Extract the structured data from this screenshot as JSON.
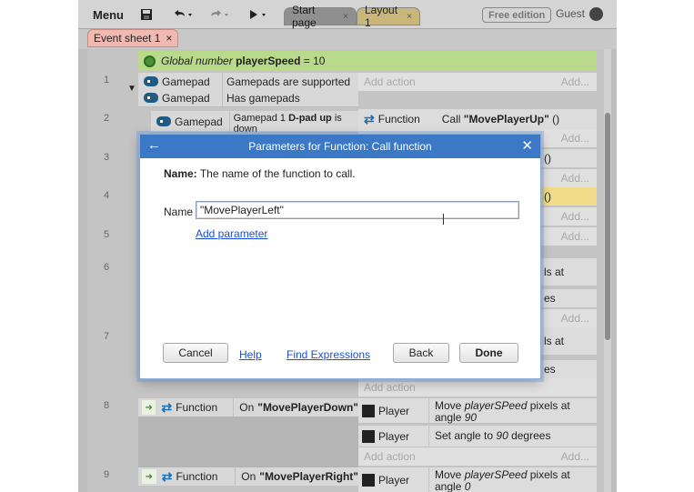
{
  "toolbar": {
    "menu_label": "Menu",
    "tabs": [
      {
        "label": "Start page",
        "close": "×"
      },
      {
        "label": "Layout 1",
        "close": "×"
      }
    ],
    "edition_badge": "Free edition",
    "user_name": "Guest"
  },
  "sheet_tab": {
    "label": "Event sheet 1",
    "close": "×"
  },
  "event_sheet": {
    "global": {
      "prefix": "Global number",
      "name": "playerSpeed",
      "value": "= 10"
    },
    "row_numbers": [
      "1",
      "2",
      "3",
      "4",
      "5",
      "6",
      "7",
      "8",
      "9"
    ],
    "conditions": [
      {
        "object": "Gamepad",
        "text": "Gamepads are supported"
      },
      {
        "object": "Gamepad",
        "text": "Has gamepads"
      },
      {
        "object": "Gamepad",
        "text_prefix": "Gamepad 1",
        "text_bold": "D-pad up",
        "text_suffix": "is down"
      }
    ],
    "add_action": "Add action",
    "add_short": "Add...",
    "row2_action": {
      "object": "Function",
      "text_prefix": "Call",
      "text_bold": "\"MovePlayerUp\"",
      "text_suffix": "()"
    },
    "visible_fragments": {
      "paren1": "()",
      "paren2": "()",
      "pixels_at1": "ls at",
      "es1": "es",
      "pixels_at2": "ls at",
      "es2": "es"
    },
    "events": [
      {
        "object": "Function",
        "text_prefix": "On",
        "text_bold": "\"MovePlayerDown\"",
        "actions": [
          {
            "object": "Player",
            "text": "Move playerSPeed pixels at angle 90",
            "line1_a": "Move ",
            "line1_i": "playerSPeed",
            "line1_b": " pixels at",
            "line2_a": "angle ",
            "line2_i": "90"
          },
          {
            "object": "Player",
            "text": "Set angle to 90 degrees",
            "line1_a": "Set angle to ",
            "line1_i": "90",
            "line1_b": " degrees"
          }
        ]
      },
      {
        "object": "Function",
        "text_prefix": "On",
        "text_bold": "\"MovePlayerRight\"",
        "actions": [
          {
            "object": "Player",
            "text": "Move playerSPeed pixels at angle 0",
            "line1_a": "Move ",
            "line1_i": "playerSPeed",
            "line1_b": " pixels at",
            "line2_a": "angle ",
            "line2_i": "0"
          }
        ]
      }
    ]
  },
  "dialog": {
    "title": "Parameters for Function: Call function",
    "desc_label": "Name:",
    "desc_text": "The name of the function to call.",
    "name_label": "Name",
    "name_value": "\"MovePlayerLeft\"",
    "add_parameter": "Add parameter",
    "cancel": "Cancel",
    "help": "Help",
    "find_expressions": "Find Expressions",
    "back": "Back",
    "done": "Done"
  },
  "colors": {
    "dialog_title_bar": "#3b78c6",
    "link": "#1a4fd6",
    "global_bg": "#b9d98b",
    "sheet_tab": "#f0b9b1",
    "layout_tab": "#c9b67a"
  }
}
